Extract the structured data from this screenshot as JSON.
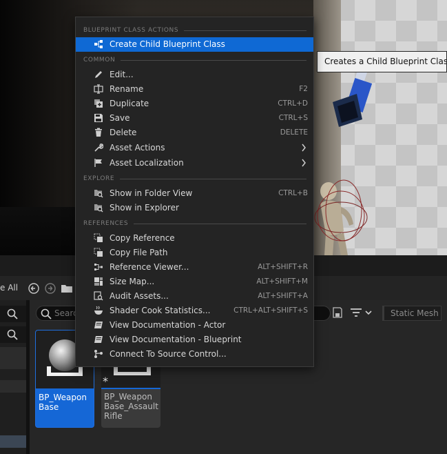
{
  "tooltip": {
    "text": "Creates a Child Blueprint Class ba"
  },
  "toolbar": {
    "save_all_label": "e All"
  },
  "search": {
    "placeholder": "Searc"
  },
  "filter": {
    "chip_label": "Static Mesh"
  },
  "assets": [
    {
      "label": "BP_Weapon Base",
      "selected": true
    },
    {
      "label": "BP_Weapon Base_Assault Rifle",
      "selected": false
    }
  ],
  "context_menu": {
    "sections": {
      "blueprint_class_actions": "BLUEPRINT CLASS ACTIONS",
      "common": "COMMON",
      "explore": "EXPLORE",
      "references": "REFERENCES"
    },
    "items": {
      "create_child": {
        "label": "Create Child Blueprint Class",
        "shortcut": "",
        "icon": "hierarchy-icon"
      },
      "edit": {
        "label": "Edit...",
        "shortcut": "",
        "icon": "pencil-icon"
      },
      "rename": {
        "label": "Rename",
        "shortcut": "F2",
        "icon": "rename-icon"
      },
      "duplicate": {
        "label": "Duplicate",
        "shortcut": "CTRL+D",
        "icon": "duplicate-icon"
      },
      "save": {
        "label": "Save",
        "shortcut": "CTRL+S",
        "icon": "save-icon"
      },
      "delete": {
        "label": "Delete",
        "shortcut": "DELETE",
        "icon": "trash-icon"
      },
      "asset_actions": {
        "label": "Asset Actions",
        "shortcut": "",
        "icon": "wrench-icon"
      },
      "asset_localization": {
        "label": "Asset Localization",
        "shortcut": "",
        "icon": "flag-icon"
      },
      "show_folder_view": {
        "label": "Show in Folder View",
        "shortcut": "CTRL+B",
        "icon": "folder-search-icon"
      },
      "show_explorer": {
        "label": "Show in Explorer",
        "shortcut": "",
        "icon": "folder-search-icon"
      },
      "copy_reference": {
        "label": "Copy Reference",
        "shortcut": "",
        "icon": "copy-icon"
      },
      "copy_file_path": {
        "label": "Copy File Path",
        "shortcut": "",
        "icon": "copy-icon"
      },
      "reference_viewer": {
        "label": "Reference Viewer...",
        "shortcut": "ALT+SHIFT+R",
        "icon": "graph-icon"
      },
      "size_map": {
        "label": "Size Map...",
        "shortcut": "ALT+SHIFT+M",
        "icon": "size-map-icon"
      },
      "audit_assets": {
        "label": "Audit Assets...",
        "shortcut": "ALT+SHIFT+A",
        "icon": "audit-icon"
      },
      "shader_cook_stats": {
        "label": "Shader Cook Statistics...",
        "shortcut": "CTRL+ALT+SHIFT+S",
        "icon": "shader-icon"
      },
      "doc_actor": {
        "label": "View Documentation - Actor",
        "shortcut": "",
        "icon": "book-icon"
      },
      "doc_blueprint": {
        "label": "View Documentation - Blueprint",
        "shortcut": "",
        "icon": "book-icon"
      },
      "source_control": {
        "label": "Connect To Source Control...",
        "shortcut": "",
        "icon": "source-control-icon"
      }
    }
  },
  "colors": {
    "highlight": "#0f69d4",
    "menu_bg": "#242424",
    "selected_tile": "#1567d6"
  }
}
